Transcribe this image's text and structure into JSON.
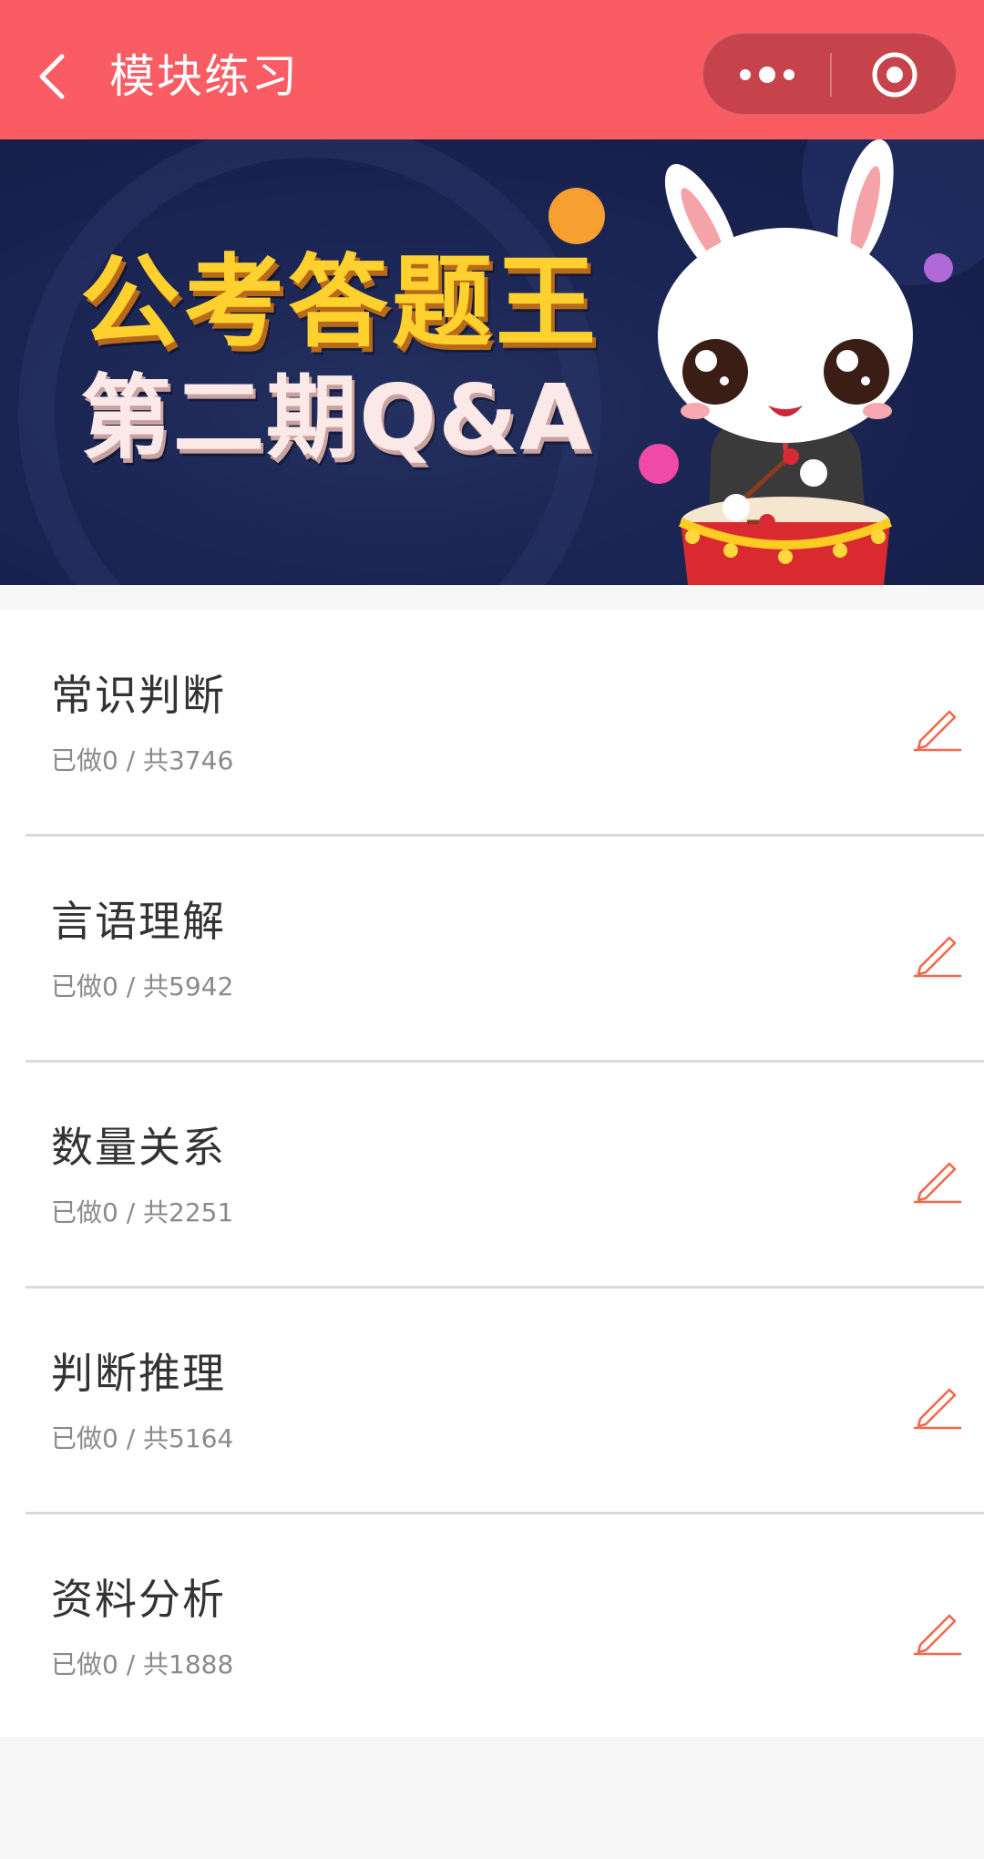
{
  "navbar": {
    "title": "模块练习",
    "background": "#fa5c64",
    "back_icon": "chevron-left-icon",
    "more_icon": "more-dots-icon",
    "close_icon": "target-circle-icon"
  },
  "banner": {
    "title": "公考答题王",
    "subtitle": "第二期Q&A",
    "background": "#1b2554",
    "title_color": "#ffd12e"
  },
  "modules": [
    {
      "name": "常识判断",
      "progress": "已做0 / 共3746"
    },
    {
      "name": "言语理解",
      "progress": "已做0 / 共5942"
    },
    {
      "name": "数量关系",
      "progress": "已做0 / 共2251"
    },
    {
      "name": "判断推理",
      "progress": "已做0 / 共5164"
    },
    {
      "name": "资料分析",
      "progress": "已做0 / 共1888"
    }
  ],
  "colors": {
    "accent": "#fa5c64",
    "edit_icon": "#ef6a4f"
  },
  "edit_icon": "pencil-icon"
}
